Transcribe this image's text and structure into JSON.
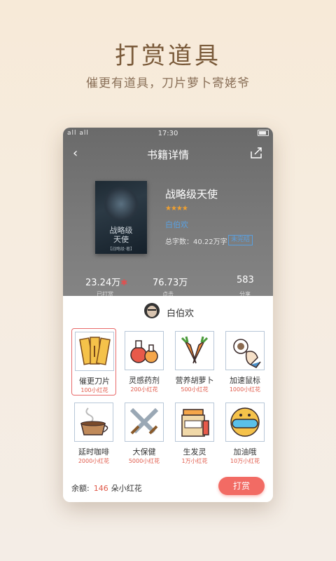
{
  "hero": {
    "title": "打赏道具",
    "subtitle": "催更有道具，刀片萝卜寄姥爷"
  },
  "status_bar": {
    "signal": "all all",
    "time": "17:30"
  },
  "nav": {
    "title": "书籍详情"
  },
  "book": {
    "cover_title": "战略级\n天使",
    "cover_sub": "【战略级·著】",
    "title": "战略级天使",
    "stars": "★★★★",
    "author": "白伯欢",
    "words": "总字数：40.22万字",
    "status_badge": "未完结"
  },
  "stats": [
    {
      "value": "23.24万",
      "label": "已打赏"
    },
    {
      "value": "76.73万",
      "label": "点击"
    },
    {
      "value": "583",
      "label": "分享"
    }
  ],
  "sheet": {
    "author_name": "白伯欢",
    "items": [
      {
        "name": "催更刀片",
        "price": "100小红花",
        "icon": "blade-icon"
      },
      {
        "name": "灵感药剂",
        "price": "200小红花",
        "icon": "potion-icon"
      },
      {
        "name": "营养胡萝卜",
        "price": "500小红花",
        "icon": "carrot-icon"
      },
      {
        "name": "加速鼠标",
        "price": "1000小红花",
        "icon": "mouse-icon"
      },
      {
        "name": "延时咖啡",
        "price": "2000小红花",
        "icon": "coffee-icon"
      },
      {
        "name": "大保健",
        "price": "5000小红花",
        "icon": "swords-icon"
      },
      {
        "name": "生发灵",
        "price": "1万小红花",
        "icon": "hair-tonic-icon"
      },
      {
        "name": "加油哦",
        "price": "10万小红花",
        "icon": "cheer-icon"
      }
    ],
    "balance_label": "余额:",
    "balance_value": "146",
    "balance_unit": "朵小红花",
    "reward_button": "打赏"
  },
  "colors": {
    "accent": "#f26b64",
    "link": "#5aa0e0",
    "price": "#e05a4a"
  }
}
